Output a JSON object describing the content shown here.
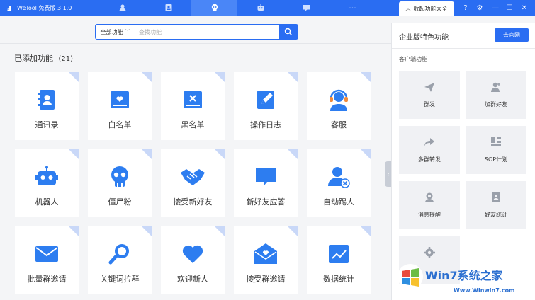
{
  "app": {
    "name": "WeTool 免费版 3.1.0",
    "logo_glyph": "ⅎ"
  },
  "titlebar": {
    "nav_icons": [
      "contacts-icon",
      "card-icon",
      "skull-icon",
      "robot-icon",
      "chat-icon",
      "more-icon"
    ],
    "more_glyph": "···",
    "collapse_tab": "收起功能大全",
    "controls": {
      "help": "?",
      "settings": "⚙",
      "minimize": "—",
      "maximize": "☐",
      "close": "✕"
    }
  },
  "search": {
    "filter": "全部功能",
    "placeholder": "查找功能"
  },
  "section": {
    "title": "已添加功能",
    "count": "(21)"
  },
  "tiles": [
    {
      "label": "通讯录",
      "icon": "address-book-icon"
    },
    {
      "label": "白名单",
      "icon": "whitelist-icon"
    },
    {
      "label": "黑名单",
      "icon": "blacklist-icon"
    },
    {
      "label": "操作日志",
      "icon": "log-icon"
    },
    {
      "label": "客服",
      "icon": "headset-icon"
    },
    {
      "label": "机器人",
      "icon": "robot-icon"
    },
    {
      "label": "僵尸粉",
      "icon": "skull-icon"
    },
    {
      "label": "接受新好友",
      "icon": "handshake-icon"
    },
    {
      "label": "新好友应答",
      "icon": "chat-bubble-icon"
    },
    {
      "label": "自动踢人",
      "icon": "kick-user-icon"
    },
    {
      "label": "批量群邀请",
      "icon": "envelope-icon"
    },
    {
      "label": "关键词拉群",
      "icon": "magnifier-icon"
    },
    {
      "label": "欢迎新人",
      "icon": "heart-icon"
    },
    {
      "label": "接受群邀请",
      "icon": "envelope-heart-icon"
    },
    {
      "label": "数据统计",
      "icon": "chart-icon"
    }
  ],
  "panel": {
    "title": "企业版特色功能",
    "button": "去官网",
    "subtitle": "客户端功能",
    "items": [
      {
        "label": "群发",
        "icon": "send-icon"
      },
      {
        "label": "加群好友",
        "icon": "add-friend-icon"
      },
      {
        "label": "多群转发",
        "icon": "forward-icon"
      },
      {
        "label": "SOP计划",
        "icon": "plan-icon"
      },
      {
        "label": "消息提醒",
        "icon": "bell-user-icon"
      },
      {
        "label": "好友统计",
        "icon": "stats-card-icon"
      },
      {
        "label": "",
        "icon": "gear-icon"
      }
    ]
  },
  "watermark": {
    "title": "Win7系统之家",
    "url": "Www.Winwin7.com"
  },
  "colors": {
    "accent": "#2a6df2",
    "icon_blue": "#2d7df0"
  }
}
